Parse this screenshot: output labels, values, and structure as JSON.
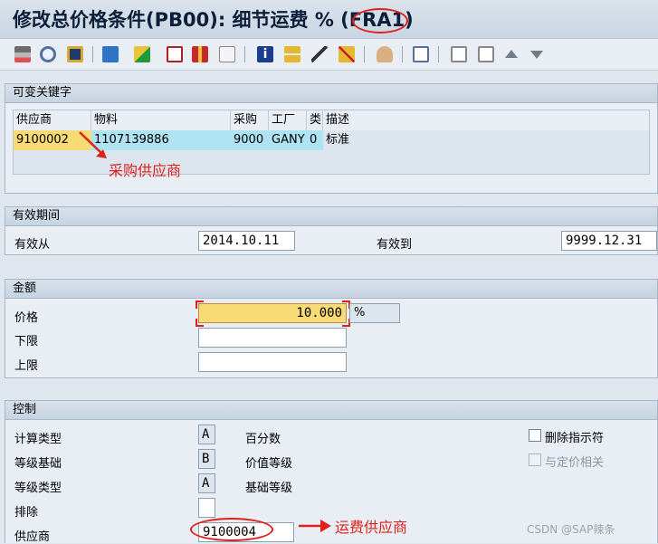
{
  "window": {
    "title": "修改总价格条件(PB00): 细节运费 % (FRA1)"
  },
  "toolbar": {
    "icons": [
      "print-icon",
      "find-icon",
      "save-icon",
      "multi-icon",
      "export-icon",
      "calendar-icon",
      "gift-icon",
      "edit-icon",
      "info-icon",
      "tree-icon",
      "key-icon",
      "filter-icon",
      "person-icon",
      "layout-icon",
      "first-page-icon",
      "last-page-icon",
      "up-arrow-icon",
      "down-arrow-icon"
    ]
  },
  "key_section": {
    "title": "可变关键字",
    "columns": [
      "供应商",
      "物料",
      "采购",
      "工厂",
      "类",
      "描述"
    ],
    "row": [
      "9100002",
      "1107139886",
      "9000",
      "GANY",
      "0",
      "标准"
    ],
    "annotation": "采购供应商"
  },
  "validity": {
    "title": "有效期间",
    "from_label": "有效从",
    "from_value": "2014.10.11",
    "to_label": "有效到",
    "to_value": "9999.12.31"
  },
  "amount": {
    "title": "金额",
    "price_label": "价格",
    "price_value": "10.000",
    "unit": "%",
    "lower_label": "下限",
    "upper_label": "上限"
  },
  "control": {
    "title": "控制",
    "calc_type_label": "计算类型",
    "calc_type_value": "A",
    "calc_type_text": "百分数",
    "scale_base_label": "等级基础",
    "scale_base_value": "B",
    "scale_base_text": "价值等级",
    "scale_type_label": "等级类型",
    "scale_type_value": "A",
    "scale_type_text": "基础等级",
    "exclusion_label": "排除",
    "vendor_label": "供应商",
    "vendor_value": "9100004",
    "vendor_annotation": "运费供应商",
    "deletion_label": "删除指示符",
    "pricing_label": "与定价相关"
  },
  "watermark": "CSDN @SAP辣条"
}
